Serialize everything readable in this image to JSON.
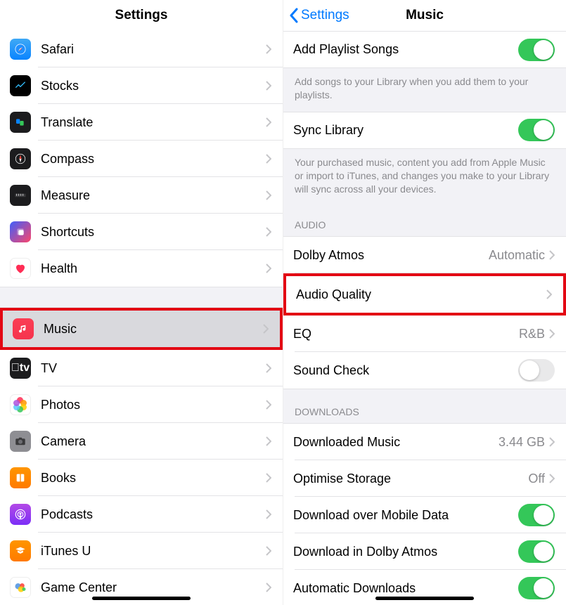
{
  "left": {
    "title": "Settings",
    "group1": [
      {
        "key": "safari",
        "label": "Safari"
      },
      {
        "key": "stocks",
        "label": "Stocks"
      },
      {
        "key": "translate",
        "label": "Translate"
      },
      {
        "key": "compass",
        "label": "Compass"
      },
      {
        "key": "measure",
        "label": "Measure"
      },
      {
        "key": "shortcuts",
        "label": "Shortcuts"
      },
      {
        "key": "health",
        "label": "Health"
      }
    ],
    "group2": [
      {
        "key": "music",
        "label": "Music",
        "highlighted": true,
        "selected": true
      },
      {
        "key": "tv",
        "label": "TV"
      },
      {
        "key": "photos",
        "label": "Photos"
      },
      {
        "key": "camera",
        "label": "Camera"
      },
      {
        "key": "books",
        "label": "Books"
      },
      {
        "key": "podcasts",
        "label": "Podcasts"
      },
      {
        "key": "itunesu",
        "label": "iTunes U"
      },
      {
        "key": "gamecenter",
        "label": "Game Center"
      }
    ]
  },
  "right": {
    "back_label": "Settings",
    "title": "Music",
    "add_playlist": {
      "label": "Add Playlist Songs",
      "on": true
    },
    "add_playlist_footer": "Add songs to your Library when you add them to your playlists.",
    "sync_library": {
      "label": "Sync Library",
      "on": true
    },
    "sync_footer": "Your purchased music, content you add from Apple Music or import to iTunes, and changes you make to your Library will sync across all your devices.",
    "audio_header": "AUDIO",
    "dolby": {
      "label": "Dolby Atmos",
      "value": "Automatic"
    },
    "audio_quality": {
      "label": "Audio Quality",
      "highlighted": true
    },
    "eq": {
      "label": "EQ",
      "value": "R&B"
    },
    "sound_check": {
      "label": "Sound Check",
      "on": false
    },
    "downloads_header": "DOWNLOADS",
    "downloaded": {
      "label": "Downloaded Music",
      "value": "3.44 GB"
    },
    "optimise": {
      "label": "Optimise Storage",
      "value": "Off"
    },
    "dl_mobile": {
      "label": "Download over Mobile Data",
      "on": true
    },
    "dl_dolby": {
      "label": "Download in Dolby Atmos",
      "on": true
    },
    "auto_dl": {
      "label": "Automatic Downloads",
      "on": true
    }
  }
}
